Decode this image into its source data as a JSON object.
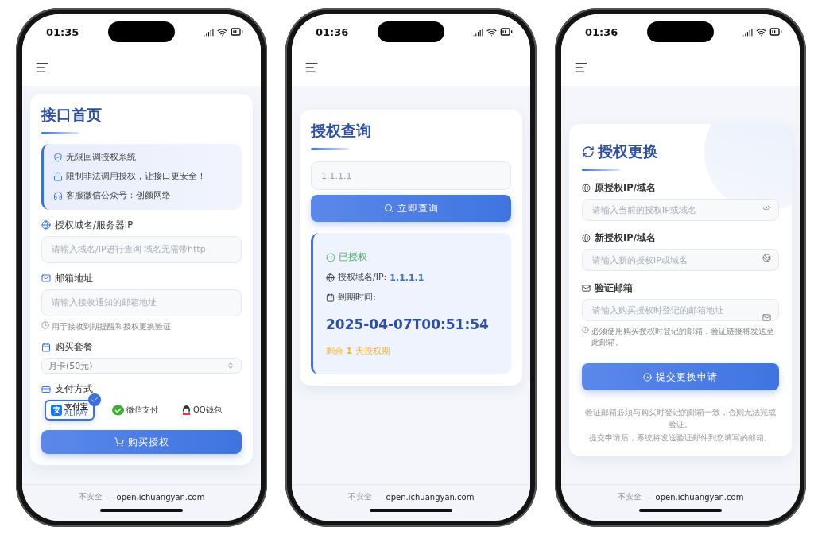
{
  "phones": [
    {
      "time": "01:35",
      "kind": "purchase",
      "address": {
        "security": "不安全",
        "separator": "—",
        "url": "open.ichuangyan.com"
      },
      "title": "接口首页",
      "notices": [
        "无限回调授权系统",
        "限制非法调用授权，让接口更安全！",
        "客服微信公众号：创颜网络"
      ],
      "fields": [
        {
          "label": "授权域名/服务器IP",
          "placeholder": "请输入域名/IP进行查询 域名无需带http"
        },
        {
          "label": "邮箱地址",
          "placeholder": "请输入接收通知的邮箱地址",
          "hint": "用于接收到期提醒和授权更换验证"
        }
      ],
      "plan": {
        "label": "购买套餐",
        "value": "月卡(50元)"
      },
      "payment": {
        "label": "支付方式",
        "options": [
          {
            "label": "支付宝",
            "sublabel": "ALIPAY",
            "selected": true
          },
          {
            "label": "微信支付",
            "selected": false
          },
          {
            "label": "QQ钱包",
            "selected": false
          }
        ]
      },
      "button": "购买授权"
    },
    {
      "time": "01:36",
      "kind": "query",
      "address": {
        "security": "不安全",
        "separator": "—",
        "url": "open.ichuangyan.com"
      },
      "title": "授权查询",
      "query": {
        "value": "1.1.1.1"
      },
      "button": "立即查询",
      "result": {
        "status": "已授权",
        "domain_label": "授权域名/IP:",
        "domain": "1.1.1.1",
        "expiry_label": "到期时间:",
        "expiry": "2025-04-07T00:51:54",
        "remaining": "剩余 **1** 天授权期"
      }
    },
    {
      "time": "01:36",
      "kind": "change",
      "address": {
        "security": "不安全",
        "separator": "—",
        "url": "open.ichuangyan.com"
      },
      "title": "授权更换",
      "fields": [
        {
          "label": "原授权IP/域名",
          "placeholder": "请输入当前的授权IP或域名"
        },
        {
          "label": "新授权IP/域名",
          "placeholder": "请输入新的授权IP或域名"
        },
        {
          "label": "验证邮箱",
          "placeholder": "请输入购买授权时登记的邮箱地址",
          "hint": "必须使用购买授权时登记的邮箱，验证链接将发送至此邮箱。"
        }
      ],
      "button": "提交更换申请",
      "notes": [
        "验证邮箱必须与购买时登记的邮箱一致，否则无法完成验证。",
        "提交申请后，系统将发送验证邮件到您填写的邮箱。"
      ]
    }
  ]
}
